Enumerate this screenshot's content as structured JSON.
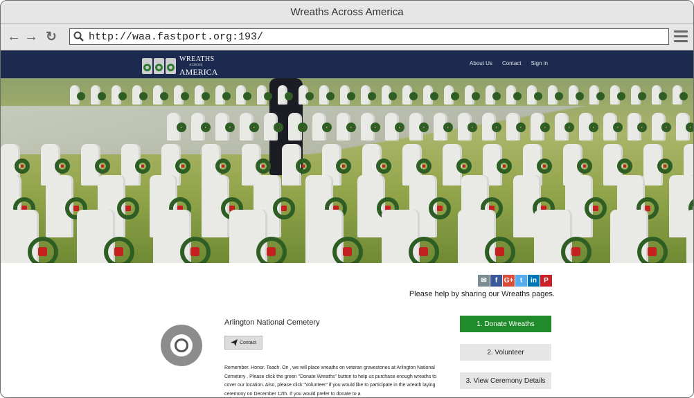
{
  "window": {
    "title": "Wreaths Across America"
  },
  "browser": {
    "url": "http://waa.fastport.org:193/"
  },
  "site": {
    "logo": {
      "line1": "WREATHS",
      "line2": "ACROSS",
      "line3": "AMERICA"
    },
    "nav": [
      "About Us",
      "Contact",
      "Sign in"
    ]
  },
  "share": {
    "icons": [
      "email-icon",
      "facebook-icon",
      "google-plus-icon",
      "twitter-icon",
      "linkedin-icon",
      "pinterest-icon"
    ],
    "glyphs": [
      "✉",
      "f",
      "G+",
      "t",
      "in",
      "P"
    ],
    "colors": [
      "#7b8b94",
      "#3b5998",
      "#dd4b39",
      "#55acee",
      "#0077b5",
      "#cb2027"
    ],
    "text": "Please help by sharing our Wreaths pages."
  },
  "cemetery": {
    "name": "Arlington National Cemetery",
    "contact_label": "Contact",
    "description": "Remember. Honor. Teach. On , we will place wreaths on veteran gravestones at Arlington National Cemetery . Please click the green \"Donate Wreaths\" button to help us purchase enough wreaths to cover our location. Also, please click \"Volunteer\" if you would like to participate in the wreath laying ceremony on December 12th. If you would prefer to donate to a"
  },
  "actions": {
    "donate": "1. Donate Wreaths",
    "volunteer": "2. Volunteer",
    "ceremony": "3. View Ceremony Details"
  },
  "colors": {
    "header": "#1b2a4e",
    "donate": "#1f8b2a"
  }
}
